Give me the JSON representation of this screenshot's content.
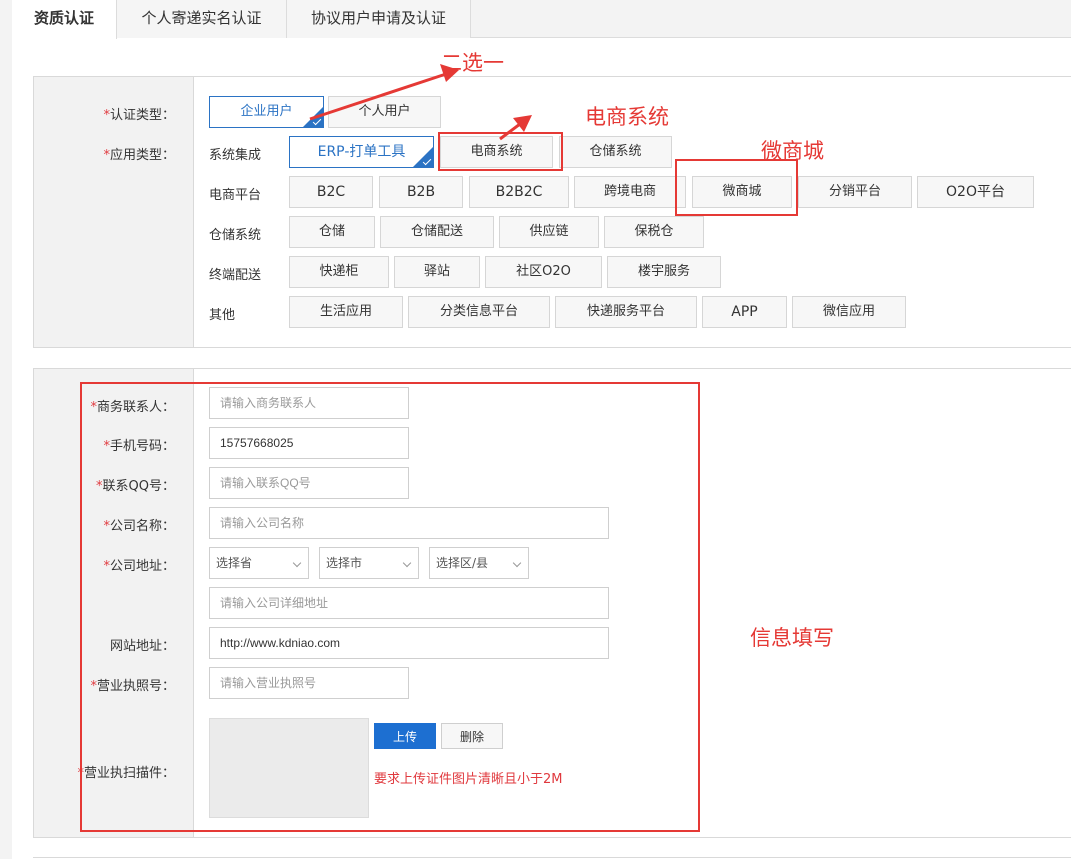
{
  "tabs": [
    {
      "label": "资质认证"
    },
    {
      "label": "个人寄递实名认证"
    },
    {
      "label": "协议用户申请及认证"
    }
  ],
  "section1": {
    "auth_type": {
      "required_mark": "*",
      "label": "认证类型：",
      "options": [
        {
          "label": "企业用户",
          "selected": true
        },
        {
          "label": "个人用户",
          "selected": false
        }
      ]
    },
    "app_type": {
      "required_mark": "*",
      "label": "应用类型：",
      "rows": [
        {
          "label": "系统集成",
          "options": [
            "ERP-打单工具",
            "电商系统",
            "仓储系统"
          ]
        },
        {
          "label": "电商平台",
          "options": [
            "B2C",
            "B2B",
            "B2B2C",
            "跨境电商",
            "微商城",
            "分销平台",
            "O2O平台"
          ]
        },
        {
          "label": "仓储系统",
          "options": [
            "仓储",
            "仓储配送",
            "供应链",
            "保税仓"
          ]
        },
        {
          "label": "终端配送",
          "options": [
            "快递柜",
            "驿站",
            "社区O2O",
            "楼宇服务"
          ]
        },
        {
          "label": "其他",
          "options": [
            "生活应用",
            "分类信息平台",
            "快递服务平台",
            "APP",
            "微信应用"
          ]
        }
      ],
      "selected": "ERP-打单工具"
    }
  },
  "section2": {
    "fields": {
      "contact": {
        "required_mark": "*",
        "label": "商务联系人：",
        "placeholder": "请输入商务联系人",
        "value": ""
      },
      "phone": {
        "required_mark": "*",
        "label": "手机号码：",
        "placeholder": "",
        "value": "15757668025"
      },
      "qq": {
        "required_mark": "*",
        "label": "联系QQ号：",
        "placeholder": "请输入联系QQ号",
        "value": ""
      },
      "company": {
        "required_mark": "*",
        "label": "公司名称：",
        "placeholder": "请输入公司名称",
        "value": ""
      },
      "address": {
        "required_mark": "*",
        "label": "公司地址：",
        "province": "选择省",
        "city": "选择市",
        "district": "选择区/县",
        "detail_placeholder": "请输入公司详细地址"
      },
      "website": {
        "label": "网站地址：",
        "placeholder": "",
        "value": "http://www.kdniao.com"
      },
      "license": {
        "required_mark": "*",
        "label": "营业执照号：",
        "placeholder": "请输入营业执照号",
        "value": ""
      },
      "scan": {
        "required_mark": "*",
        "label": "营业执扫描件：",
        "upload_label": "上传",
        "delete_label": "删除",
        "hint": "要求上传证件图片清晰且小于2M"
      }
    }
  },
  "annotations": {
    "choose_one": "二选一",
    "ecommerce_system": "电商系统",
    "micro_mall": "微商城",
    "info_fill": "信息填写",
    "color": "#e53935"
  },
  "colors": {
    "accent": "#2b73c4",
    "upload_button": "#1d6fd1",
    "required": "#e0393e"
  }
}
